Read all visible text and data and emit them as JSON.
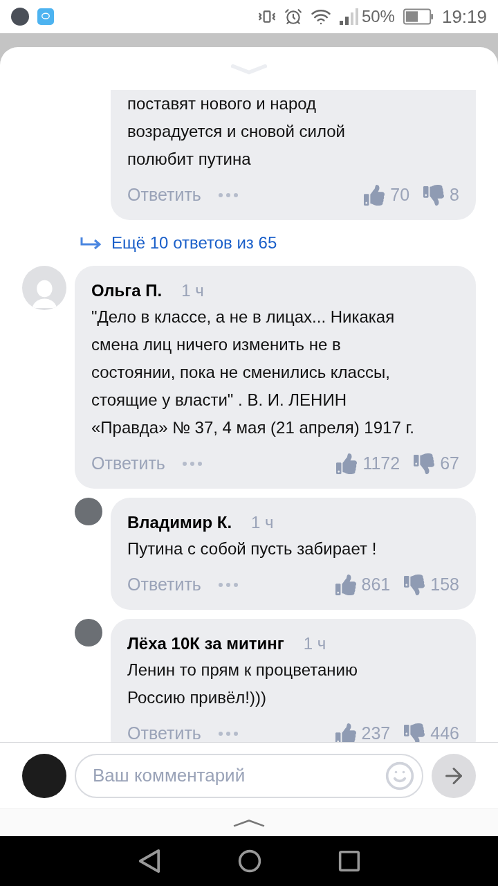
{
  "status_bar": {
    "battery_text": "50%",
    "time": "19:19"
  },
  "items": [
    {
      "kind": "comment",
      "reply": true,
      "text": "поставят нового и народ\nвозрадуется и сновой силой\nполюбит путина",
      "reply_label": "Ответить",
      "likes": "70",
      "dislikes": "8"
    },
    {
      "kind": "more",
      "label": "Ещё 10 ответов из 65"
    },
    {
      "kind": "comment",
      "reply": false,
      "avatar": {
        "kind": "silhouette"
      },
      "author": "Ольга П.",
      "time": "1 ч",
      "text": "\"Дело в классе, а не в лицах... Никакая\nсмена лиц ничего изменить не в\nсостоянии, пока не сменились классы,\nстоящие у власти\" . В. И. ЛЕНИН\n«Правда» № 37, 4 мая (21 апреля) 1917 г.",
      "reply_label": "Ответить",
      "likes": "1172",
      "dislikes": "67"
    },
    {
      "kind": "comment",
      "reply": true,
      "avatar": {
        "kind": "photo"
      },
      "author": "Владимир К.",
      "time": "1 ч",
      "text": "Путина с собой пусть забирает !",
      "reply_label": "Ответить",
      "likes": "861",
      "dislikes": "158"
    },
    {
      "kind": "comment",
      "reply": true,
      "avatar": {
        "kind": "photo"
      },
      "author": "Лёха 10К за митинг",
      "time": "1 ч",
      "text": "Ленин то прям к процветанию\nРоссию привёл!)))",
      "reply_label": "Ответить",
      "likes": "237",
      "dislikes": "446"
    }
  ],
  "composer": {
    "placeholder": "Ваш комментарий"
  }
}
